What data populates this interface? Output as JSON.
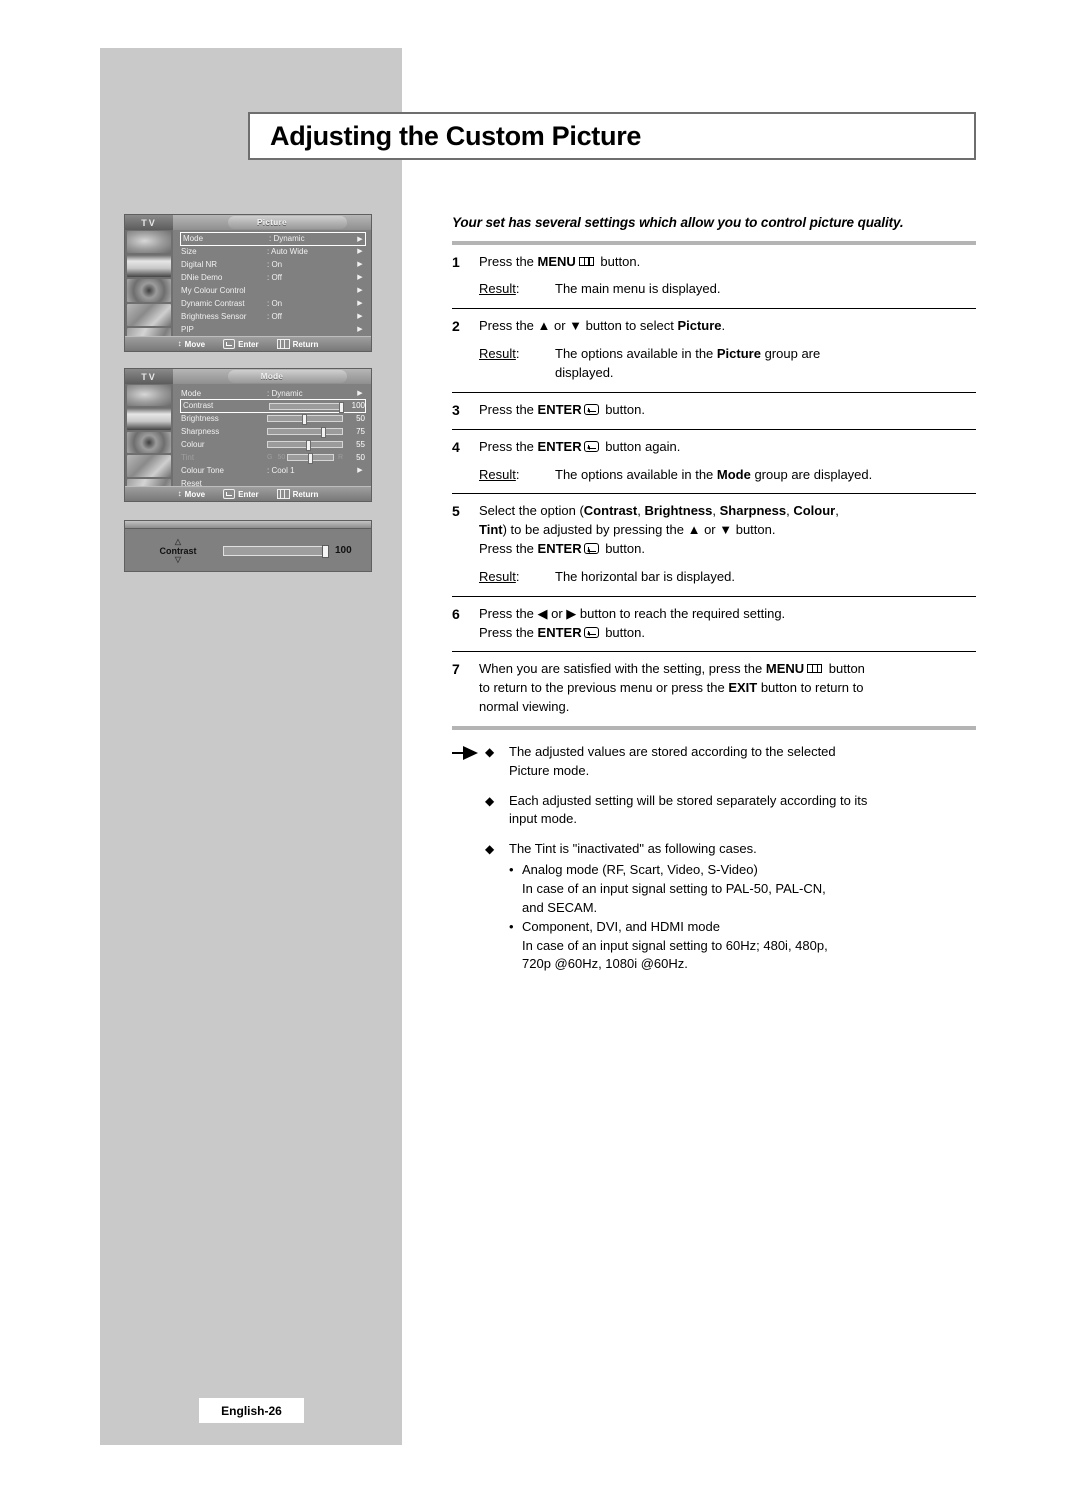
{
  "page": {
    "title": "Adjusting the Custom Picture",
    "badge": "English-26",
    "lead": "Your set has several settings which allow you to control picture quality."
  },
  "menus": {
    "picture": {
      "device_label": "TV",
      "tab": "Picture",
      "rows": [
        {
          "label": "Mode",
          "value": ": Dynamic",
          "arrow": "▶",
          "selected": true
        },
        {
          "label": "Size",
          "value": ": Auto Wide",
          "arrow": "▶",
          "selected": false
        },
        {
          "label": "Digital NR",
          "value": ": On",
          "arrow": "▶",
          "selected": false
        },
        {
          "label": "DNie Demo",
          "value": ": Off",
          "arrow": "▶",
          "selected": false
        },
        {
          "label": "My Colour Control",
          "value": "",
          "arrow": "▶",
          "selected": false
        },
        {
          "label": "Dynamic Contrast",
          "value": ": On",
          "arrow": "▶",
          "selected": false
        },
        {
          "label": "Brightness Sensor",
          "value": ": Off",
          "arrow": "▶",
          "selected": false
        },
        {
          "label": "PIP",
          "value": "",
          "arrow": "▶",
          "selected": false
        }
      ]
    },
    "mode": {
      "device_label": "TV",
      "tab": "Mode",
      "rows": [
        {
          "type": "value",
          "label": "Mode",
          "value": ": Dynamic",
          "arrow": "▶"
        },
        {
          "type": "slider",
          "label": "Contrast",
          "number": "100",
          "percent": 100,
          "boxed": true
        },
        {
          "type": "slider",
          "label": "Brightness",
          "number": "50",
          "percent": 50,
          "boxed": false
        },
        {
          "type": "slider",
          "label": "Sharpness",
          "number": "75",
          "percent": 75,
          "boxed": false
        },
        {
          "type": "slider",
          "label": "Colour",
          "number": "55",
          "percent": 55,
          "boxed": false
        },
        {
          "type": "tint",
          "label": "Tint",
          "left_letter": "G",
          "left_number": "50",
          "right_letter": "R",
          "right_number": "50",
          "percent": 50
        },
        {
          "type": "value",
          "label": "Colour Tone",
          "value": ": Cool 1",
          "arrow": "▶"
        },
        {
          "type": "value",
          "label": "Reset",
          "value": "",
          "arrow": ""
        }
      ]
    },
    "bar_popup": {
      "label": "Contrast",
      "number": "100",
      "percent": 100,
      "up_glyph": "△",
      "down_glyph": "▽"
    },
    "footer": {
      "move": "Move",
      "enter": "Enter",
      "return": "Return",
      "move_glyph": "↕"
    }
  },
  "steps": [
    {
      "num": "1",
      "lines": [
        {
          "parts": [
            {
              "t": "Press the "
            },
            {
              "t": "MENU",
              "b": true
            },
            {
              "icon": "menu"
            },
            {
              "t": " button."
            }
          ]
        }
      ],
      "result_label": "Result",
      "result": [
        {
          "parts": [
            {
              "t": "The main menu is displayed."
            }
          ]
        }
      ]
    },
    {
      "num": "2",
      "lines": [
        {
          "parts": [
            {
              "t": "Press the ▲ or ▼ button to select "
            },
            {
              "t": "Picture",
              "b": true
            },
            {
              "t": "."
            }
          ]
        }
      ],
      "result_label": "Result",
      "result": [
        {
          "parts": [
            {
              "t": "The options available in the "
            },
            {
              "t": "Picture",
              "b": true
            },
            {
              "t": " group are"
            }
          ]
        },
        {
          "parts": [
            {
              "t": "displayed."
            }
          ]
        }
      ]
    },
    {
      "num": "3",
      "lines": [
        {
          "parts": [
            {
              "t": "Press the "
            },
            {
              "t": "ENTER",
              "b": true
            },
            {
              "icon": "enter"
            },
            {
              "t": " button."
            }
          ]
        }
      ],
      "result_label": "",
      "result": []
    },
    {
      "num": "4",
      "lines": [
        {
          "parts": [
            {
              "t": "Press the "
            },
            {
              "t": "ENTER",
              "b": true
            },
            {
              "icon": "enter"
            },
            {
              "t": " button again."
            }
          ]
        }
      ],
      "result_label": "Result",
      "result": [
        {
          "parts": [
            {
              "t": "The options available in the "
            },
            {
              "t": "Mode",
              "b": true
            },
            {
              "t": " group are displayed."
            }
          ]
        }
      ]
    },
    {
      "num": "5",
      "lines": [
        {
          "parts": [
            {
              "t": "Select the option ("
            },
            {
              "t": "Contrast",
              "b": true
            },
            {
              "t": ", "
            },
            {
              "t": "Brightness",
              "b": true
            },
            {
              "t": ", "
            },
            {
              "t": "Sharpness",
              "b": true
            },
            {
              "t": ", "
            },
            {
              "t": "Colour",
              "b": true
            },
            {
              "t": ","
            }
          ]
        },
        {
          "parts": [
            {
              "t": "Tint",
              "b": true
            },
            {
              "t": ") to be adjusted by pressing the ▲ or ▼ button."
            }
          ]
        },
        {
          "parts": [
            {
              "t": "Press the "
            },
            {
              "t": "ENTER",
              "b": true
            },
            {
              "icon": "enter"
            },
            {
              "t": " button."
            }
          ]
        }
      ],
      "result_label": "Result",
      "result": [
        {
          "parts": [
            {
              "t": "The horizontal bar is displayed."
            }
          ]
        }
      ]
    },
    {
      "num": "6",
      "lines": [
        {
          "parts": [
            {
              "t": "Press the ◀ or ▶ button to reach the required setting."
            }
          ]
        },
        {
          "parts": [
            {
              "t": "Press the "
            },
            {
              "t": "ENTER",
              "b": true
            },
            {
              "icon": "enter"
            },
            {
              "t": " button."
            }
          ]
        }
      ],
      "result_label": "",
      "result": []
    },
    {
      "num": "7",
      "lines": [
        {
          "parts": [
            {
              "t": "When you are satisfied with the setting, press the "
            },
            {
              "t": "MENU",
              "b": true
            },
            {
              "icon": "menu"
            },
            {
              "t": " button"
            }
          ]
        },
        {
          "parts": [
            {
              "t": "to return to the previous menu or press the "
            },
            {
              "t": "EXIT",
              "b": true
            },
            {
              "t": " button to return to"
            }
          ]
        },
        {
          "parts": [
            {
              "t": "normal viewing."
            }
          ]
        }
      ],
      "result_label": "",
      "result": []
    }
  ],
  "notes": [
    {
      "diamond": "◆",
      "lines": [
        "The adjusted values are stored according to the selected",
        "Picture mode."
      ],
      "subs": []
    },
    {
      "diamond": "◆",
      "lines": [
        "Each adjusted setting will be stored separately according to its",
        "input mode."
      ],
      "subs": []
    },
    {
      "diamond": "◆",
      "lines": [
        "The Tint is \"inactivated\" as following cases."
      ],
      "subs": [
        {
          "bullet": "•",
          "lines": [
            "Analog mode (RF, Scart, Video, S-Video)",
            "In case of an input signal setting to PAL-50, PAL-CN,",
            "and SECAM."
          ]
        },
        {
          "bullet": "•",
          "lines": [
            "Component, DVI, and HDMI mode",
            "In case of an input signal setting to 60Hz; 480i, 480p,",
            "720p @60Hz, 1080i @60Hz."
          ]
        }
      ]
    }
  ]
}
